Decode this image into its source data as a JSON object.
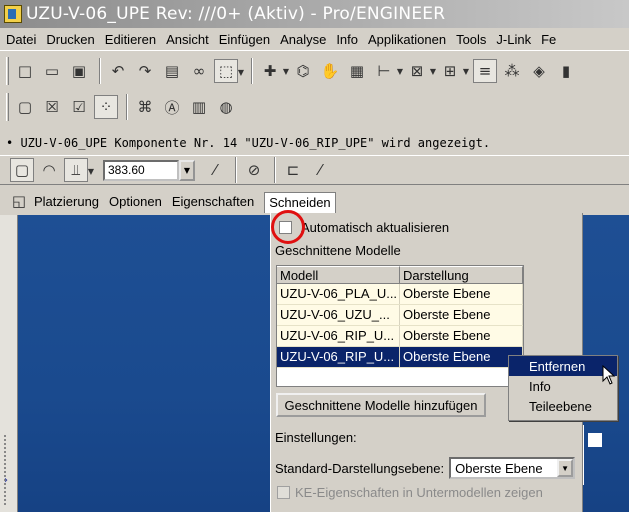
{
  "window": {
    "title": "UZU-V-06_UPE Rev: ///0+ (Aktiv) - Pro/ENGINEER"
  },
  "menu": [
    "Datei",
    "Drucken",
    "Editieren",
    "Ansicht",
    "Einfügen",
    "Analyse",
    "Info",
    "Applikationen",
    "Tools",
    "J-Link",
    "Fe"
  ],
  "status_message": "• UZU-V-06_UPE Komponente Nr. 14 \"UZU-V-06_RIP_UPE\" wird angezeigt.",
  "feature_bar": {
    "dimension_value": "383.60"
  },
  "tabs": [
    "Platzierung",
    "Optionen",
    "Eigenschaften",
    "Schneiden"
  ],
  "active_tab": "Schneiden",
  "panel": {
    "auto_update_label": "Automatisch aktualisieren",
    "section_label": "Geschnittene Modelle",
    "table": {
      "headers": [
        "Modell",
        "Darstellung"
      ],
      "rows": [
        [
          "UZU-V-06_PLA_U...",
          "Oberste Ebene"
        ],
        [
          "UZU-V-06_UZU_...",
          "Oberste Ebene"
        ],
        [
          "UZU-V-06_RIP_U...",
          "Oberste Ebene"
        ],
        [
          "UZU-V-06_RIP_U...",
          "Oberste Ebene"
        ]
      ],
      "selected_row": 3
    },
    "add_button": "Geschnittene Modelle hinzufügen",
    "settings_label": "Einstellungen:",
    "std_level_label": "Standard-Darstellungsebene:",
    "std_level_value": "Oberste Ebene",
    "ke_label": "KE-Eigenschaften in Untermodellen zeigen"
  },
  "context_menu": [
    "Entfernen",
    "Info",
    "Teileebene"
  ],
  "colors": {
    "selection": "#0a246a",
    "graphics_bg": "#1a4a8e",
    "highlight_circle": "#e01010"
  }
}
